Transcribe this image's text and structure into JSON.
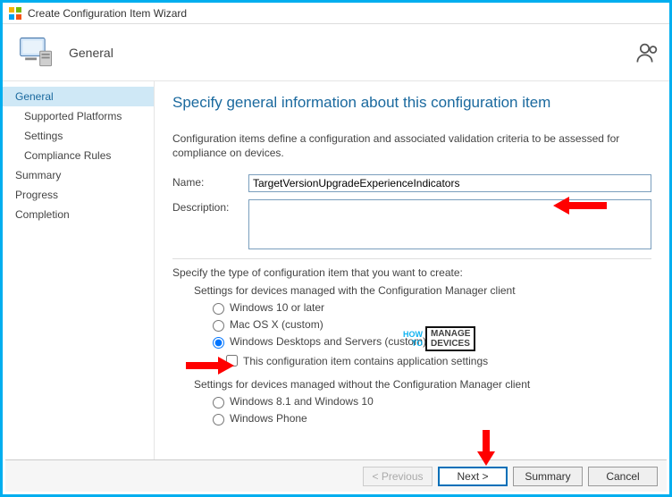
{
  "window": {
    "title": "Create Configuration Item Wizard"
  },
  "header": {
    "page_title": "General"
  },
  "sidebar": {
    "items": [
      {
        "label": "General",
        "selected": true,
        "sub": false
      },
      {
        "label": "Supported Platforms",
        "selected": false,
        "sub": true
      },
      {
        "label": "Settings",
        "selected": false,
        "sub": true
      },
      {
        "label": "Compliance Rules",
        "selected": false,
        "sub": true
      },
      {
        "label": "Summary",
        "selected": false,
        "sub": false
      },
      {
        "label": "Progress",
        "selected": false,
        "sub": false
      },
      {
        "label": "Completion",
        "selected": false,
        "sub": false
      }
    ]
  },
  "main": {
    "heading": "Specify general information about this configuration item",
    "intro": "Configuration items define a configuration and associated validation criteria to be assessed for compliance on devices.",
    "name_label": "Name:",
    "name_value": "TargetVersionUpgradeExperienceIndicators",
    "desc_label": "Description:",
    "desc_value": "",
    "type_heading": "Specify the type of configuration item that you want to create:",
    "group_with_label": "Settings for devices managed with the Configuration Manager client",
    "opt_win10": "Windows 10 or later",
    "opt_macos": "Mac OS X (custom)",
    "opt_winsrv": "Windows Desktops and Servers (custom)",
    "check_app": "This configuration item contains application settings",
    "group_without_label": "Settings for devices managed without the Configuration Manager client",
    "opt_win81": "Windows 8.1 and Windows 10",
    "opt_wp": "Windows Phone"
  },
  "footer": {
    "previous": "< Previous",
    "next": "Next >",
    "summary": "Summary",
    "cancel": "Cancel"
  },
  "watermark": {
    "left1": "HOW",
    "left2": "TO",
    "box1": "MANAGE",
    "box2": "DEVICES"
  }
}
